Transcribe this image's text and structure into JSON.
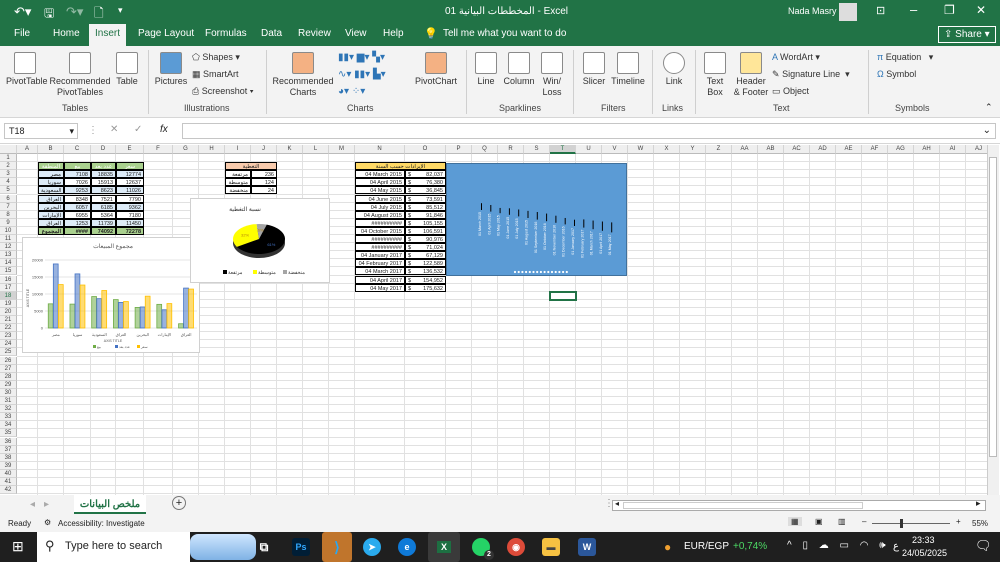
{
  "titlebar": {
    "title": "01 المخططات البيانية  -  Excel",
    "user": "Nada Masry"
  },
  "tabs": [
    "File",
    "Home",
    "Insert",
    "Page Layout",
    "Formulas",
    "Data",
    "Review",
    "View",
    "Help"
  ],
  "tell_me": "Tell me what you want to do",
  "share": "Share",
  "ribbon": {
    "tables": {
      "label": "Tables",
      "pivottable": "PivotTable",
      "recommended_pivot": "Recommended PivotTables",
      "table": "Table"
    },
    "illustrations": {
      "label": "Illustrations",
      "pictures": "Pictures",
      "shapes": "Shapes",
      "smartart": "SmartArt",
      "screenshot": "Screenshot"
    },
    "charts": {
      "label": "Charts",
      "recommended": "Recommended Charts",
      "pivotchart": "PivotChart"
    },
    "sparklines": {
      "label": "Sparklines",
      "line": "Line",
      "column": "Column",
      "winloss": "Win/ Loss"
    },
    "filters": {
      "label": "Filters",
      "slicer": "Slicer",
      "timeline": "Timeline"
    },
    "links": {
      "label": "Links",
      "link": "Link"
    },
    "text": {
      "label": "Text",
      "textbox": "Text Box",
      "header_footer": "Header & Footer",
      "wordart": "WordArt",
      "signature": "Signature Line",
      "object": "Object"
    },
    "symbols": {
      "label": "Symbols",
      "equation": "Equation",
      "symbol": "Symbol"
    }
  },
  "formula": {
    "name_box": "T18",
    "fx": "fx",
    "value": ""
  },
  "sheet": {
    "columns": [
      "A",
      "B",
      "C",
      "D",
      "E",
      "F",
      "G",
      "H",
      "I",
      "J",
      "K",
      "L",
      "M",
      "N",
      "O",
      "P",
      "Q",
      "R",
      "S",
      "T",
      "U",
      "V",
      "W",
      "X",
      "Y",
      "Z",
      "AA",
      "AB",
      "AC",
      "AD",
      "AE",
      "AF",
      "AG",
      "AH",
      "AI",
      "AJ"
    ],
    "row_count": 42,
    "selected_cell": "T18"
  },
  "sales_table": {
    "header": [
      "المنطقة",
      "بيع",
      "عدد بعد",
      "سعر"
    ],
    "rows": [
      [
        "مصر",
        "7108",
        "18835",
        "12774"
      ],
      [
        "سوريا",
        "7026",
        "15913",
        "12637"
      ],
      [
        "السعودية",
        "9253",
        "8623",
        "11026"
      ],
      [
        "العراق",
        "8348",
        "7521",
        "7790"
      ],
      [
        "البحرين",
        "6057",
        "6185",
        "9362"
      ],
      [
        "الإمارات",
        "6955",
        "5364",
        "7180"
      ],
      [
        "العراق",
        "1253",
        "11739",
        "11450"
      ]
    ],
    "total": [
      "المجموع",
      "####",
      "74092",
      "72278"
    ]
  },
  "coverage_table": {
    "header": "التغطية",
    "rows": [
      [
        "مرتفعة",
        "236"
      ],
      [
        "متوسطة",
        "124"
      ],
      [
        "منخفضة",
        "24"
      ]
    ]
  },
  "revenue_table": {
    "header": "الإيرادات حسب السنة",
    "rows": [
      [
        "04 March 2015",
        "$",
        "82,037"
      ],
      [
        "04 April 2015",
        "$",
        "76,380"
      ],
      [
        "04 May 2015",
        "$",
        "36,845"
      ],
      [
        "04 June 2015",
        "$",
        "73,591"
      ],
      [
        "04 July 2015",
        "$",
        "85,512"
      ],
      [
        "04 August 2015",
        "$",
        "91,846"
      ],
      [
        "##########",
        "$",
        "105,155"
      ],
      [
        "04 October 2015",
        "$",
        "106,591"
      ],
      [
        "##########",
        "$",
        "90,976"
      ],
      [
        "##########",
        "$",
        "71,024"
      ],
      [
        "04 January 2017",
        "$",
        "67,129"
      ],
      [
        "04 February 2017",
        "$",
        "122,589"
      ],
      [
        "04 March 2017",
        "$",
        "136,532"
      ],
      [
        "04 April 2017",
        "$",
        "154,952"
      ],
      [
        "04 May 2017",
        "$",
        "175,632"
      ]
    ]
  },
  "chart_data": [
    {
      "type": "bar",
      "title": "مجموع المبيعات",
      "xlabel": "AXIS TITLE",
      "ylabel": "AXIS TITLE",
      "ylim": [
        0,
        20000
      ],
      "yticks": [
        "0",
        "5000",
        "10000",
        "15000",
        "20000"
      ],
      "categories": [
        "مصر",
        "سوريا",
        "السعودية",
        "العراق",
        "البحرين",
        "الإمارات",
        "العراق"
      ],
      "series": [
        {
          "name": "بيع",
          "color": "#70ad47",
          "values": [
            7108,
            7026,
            9253,
            8348,
            6057,
            6955,
            1253
          ]
        },
        {
          "name": "عدد بعد",
          "color": "#4472c4",
          "values": [
            18835,
            15913,
            8623,
            7521,
            6185,
            5364,
            11739
          ]
        },
        {
          "name": "سعر",
          "color": "#ffc000",
          "values": [
            12774,
            12637,
            11026,
            7790,
            9362,
            7180,
            11450
          ]
        }
      ],
      "legend": "bottom"
    },
    {
      "type": "pie",
      "title": "نسبة التغطية",
      "categories": [
        "مرتفعة",
        "متوسطة",
        "منخفضة"
      ],
      "values": [
        236,
        124,
        24
      ],
      "labels": [
        "61%",
        "32%",
        "6%"
      ],
      "colors": [
        "#000000",
        "#ffff00",
        "#a5a5a5"
      ],
      "legend": "bottom"
    },
    {
      "type": "bar",
      "title": "",
      "background": "#5b9bd5",
      "categories": [
        "01 March 2015",
        "01 April 2015",
        "01 May 2015",
        "01 June 2015",
        "01 July 2015",
        "01 August 2015",
        "01 September 2016",
        "01 October 2016",
        "01 November 2016",
        "01 December 2016",
        "01 January 2017",
        "01 February 2017",
        "01 March 2017",
        "01 April 2017",
        "01 May 2017"
      ],
      "values": [
        82037,
        76380,
        36845,
        73591,
        85512,
        91846,
        105155,
        106591,
        90976,
        71024,
        67129,
        122589,
        136532,
        154952,
        175632
      ]
    }
  ],
  "sheet_tabs": {
    "active": "ملخص البيانات",
    "add": "+"
  },
  "status": {
    "ready": "Ready",
    "accessibility": "Accessibility: Investigate",
    "zoom": "55%"
  },
  "taskbar": {
    "search": "Type here to search",
    "ticker": "EUR/EGP",
    "ticker_change": "+0,74%",
    "time": "23:33",
    "date": "24/05/2025",
    "lang": "ع",
    "whatsapp_badge": "2"
  }
}
